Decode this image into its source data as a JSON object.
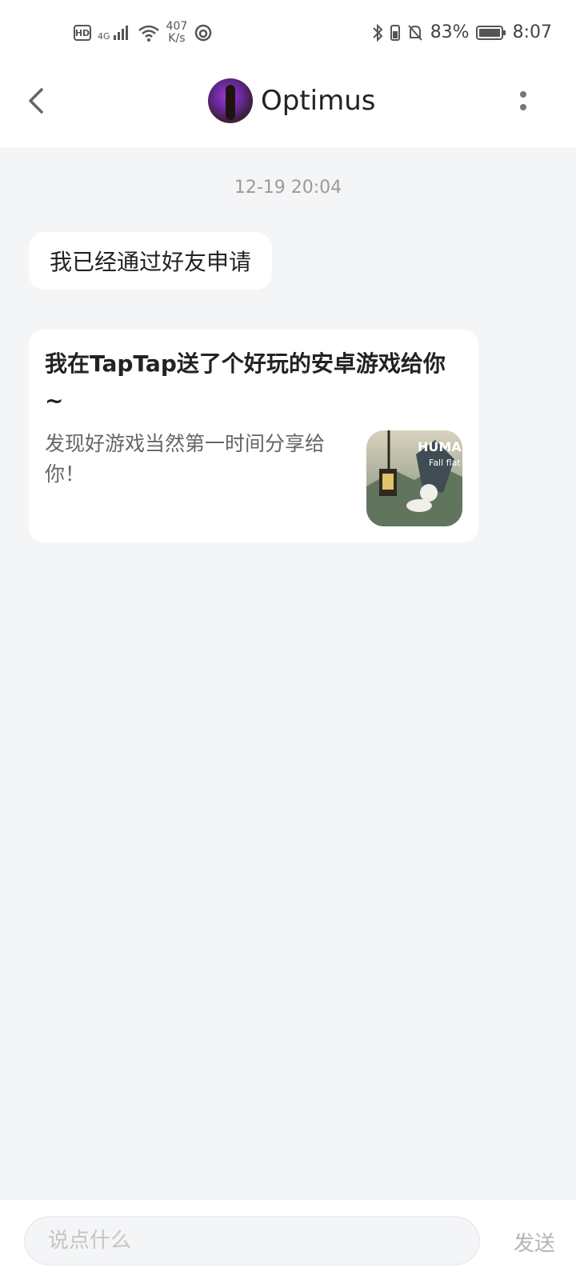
{
  "status_bar": {
    "hd": "HD",
    "network_type": "4G",
    "speed_value": "407",
    "speed_unit": "K/s",
    "battery_percent": "83%",
    "time": "8:07"
  },
  "header": {
    "title": "Optimus"
  },
  "chat": {
    "timestamp": "12-19 20:04",
    "messages": [
      {
        "text": "我已经通过好友申请"
      }
    ],
    "share_card": {
      "title": "我在TapTap送了个好玩的安卓游戏给你~",
      "description": "发现好游戏当然第一时间分享给你！",
      "game_logo_line1": "HUMAN",
      "game_logo_line2": "Fall flat"
    }
  },
  "composer": {
    "placeholder": "说点什么",
    "send_label": "发送"
  }
}
